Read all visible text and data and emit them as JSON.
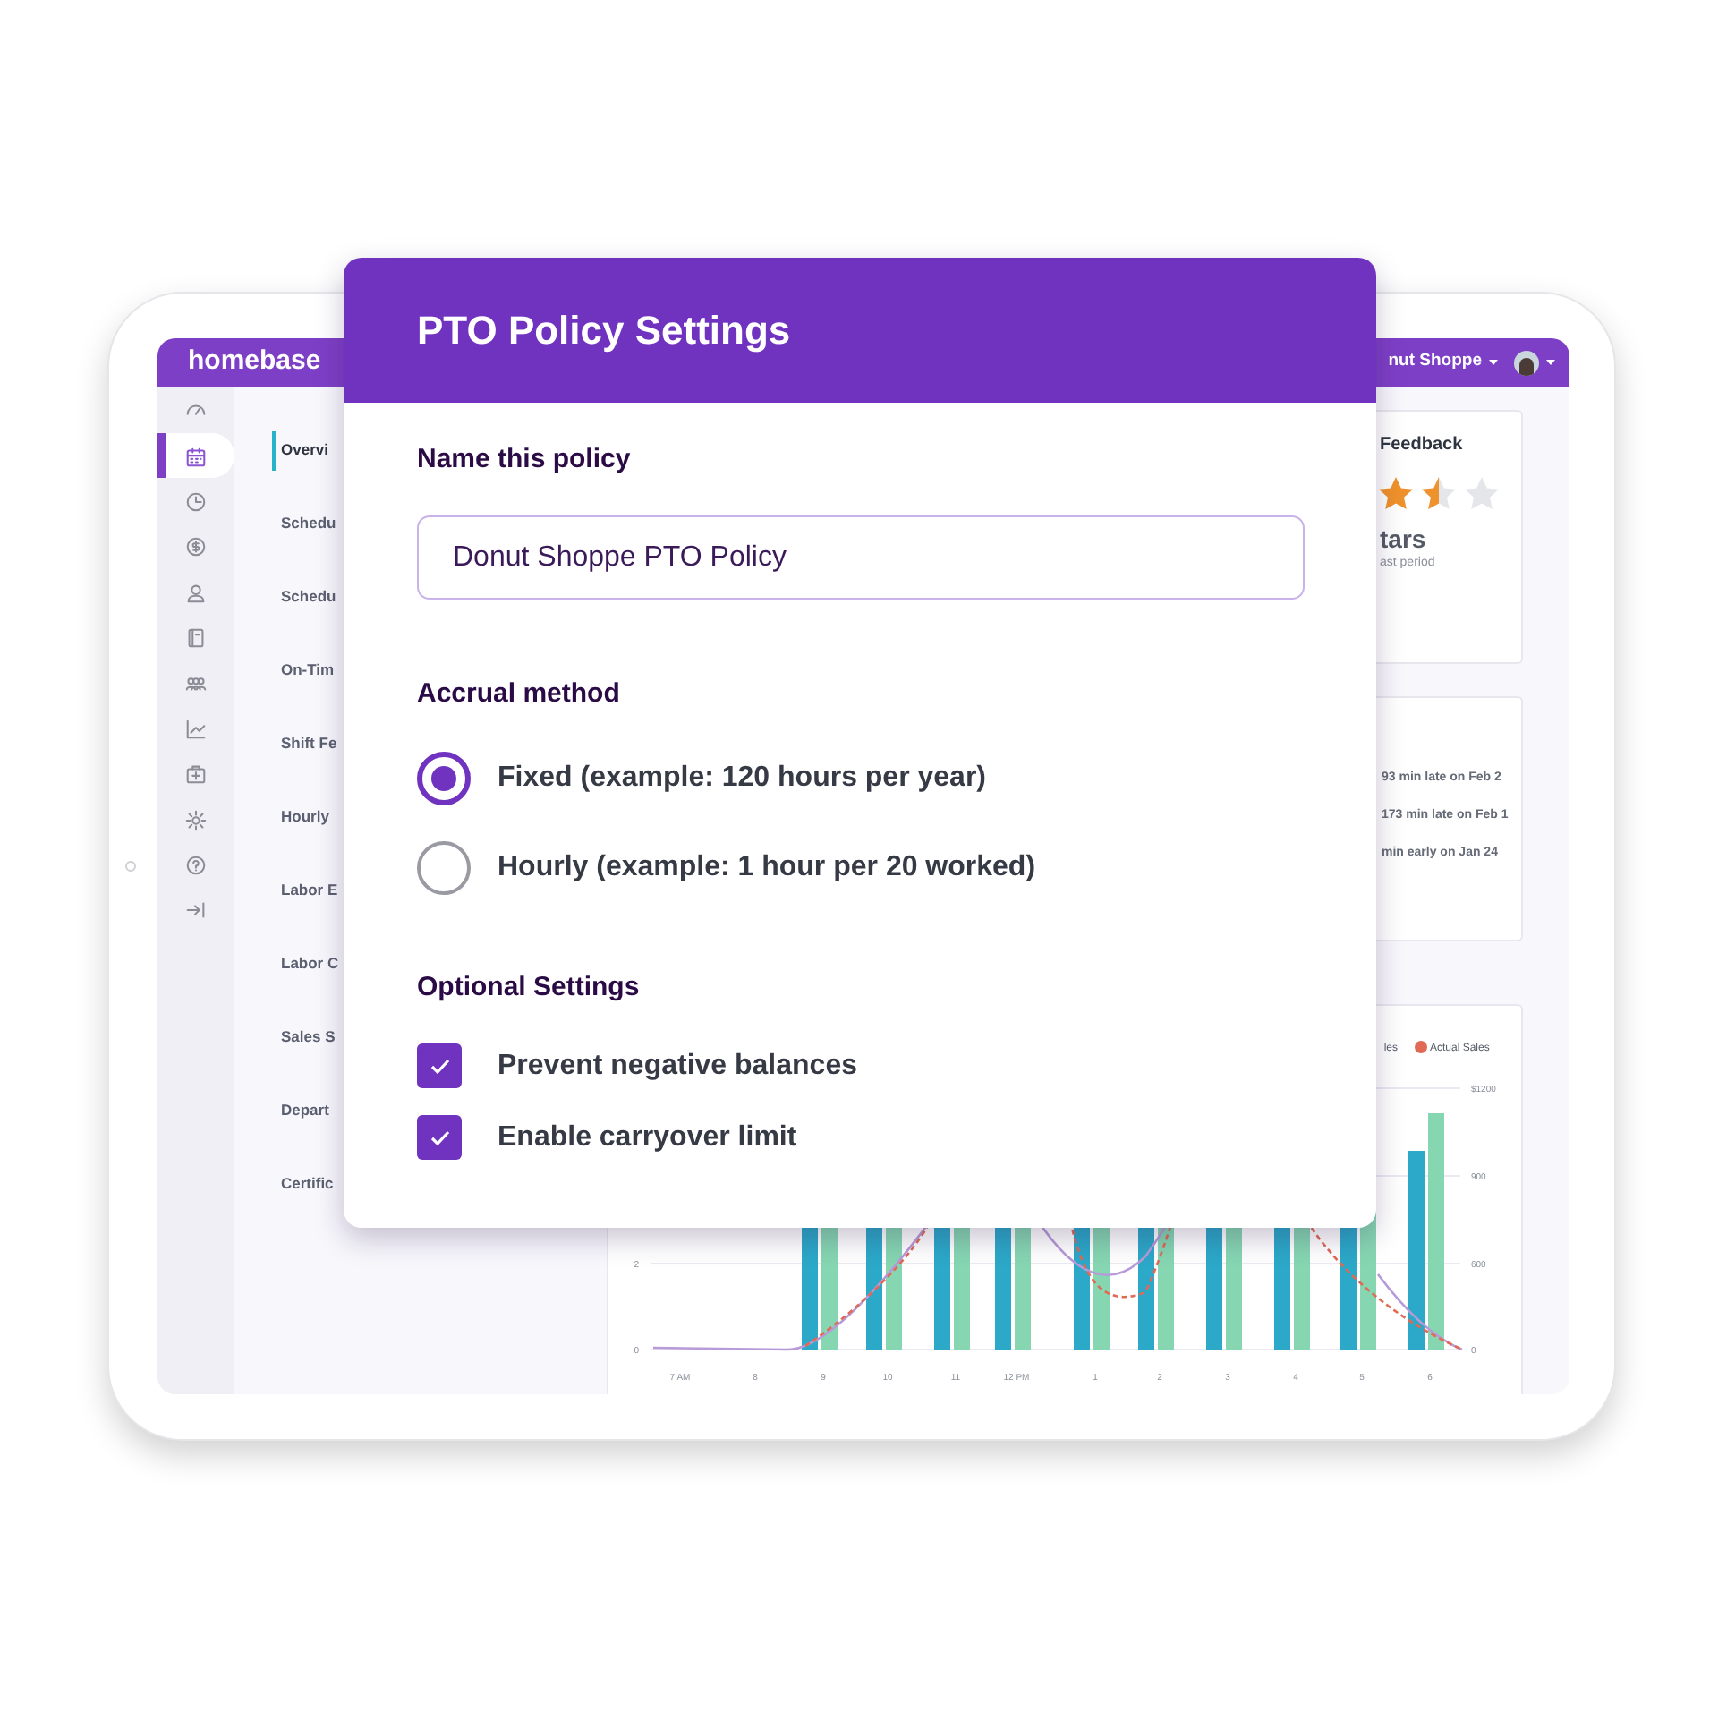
{
  "app": {
    "logo": "homebase",
    "location": "nut Shoppe"
  },
  "sidebar": {
    "icons": [
      {
        "selected": false
      },
      {
        "selected": true
      },
      {
        "selected": false
      },
      {
        "selected": false
      },
      {
        "selected": false
      },
      {
        "selected": false
      },
      {
        "selected": false
      },
      {
        "selected": false
      },
      {
        "selected": false
      },
      {
        "selected": false
      },
      {
        "selected": false
      },
      {
        "selected": false
      }
    ]
  },
  "nav": [
    {
      "label": "Overvi",
      "selected": true
    },
    {
      "label": "Schedu",
      "selected": false
    },
    {
      "label": "Schedu",
      "selected": false
    },
    {
      "label": "On-Tim",
      "selected": false
    },
    {
      "label": "Shift Fe",
      "selected": false
    },
    {
      "label": "Hourly",
      "selected": false
    },
    {
      "label": "Labor E",
      "selected": false
    },
    {
      "label": "Labor C",
      "selected": false
    },
    {
      "label": "Sales S",
      "selected": false
    },
    {
      "label": "Depart",
      "selected": false
    },
    {
      "label": "Certific",
      "selected": false
    }
  ],
  "feedback_card": {
    "title": "Feedback",
    "stars": 1.5,
    "rating": "tars",
    "caption": "ast period"
  },
  "punctuality_card": {
    "lines": [
      "93 min late on Feb 2",
      "173 min late on Feb 1",
      "min early on Jan 24"
    ]
  },
  "sales_chart": {
    "legend": [
      {
        "label": "les"
      },
      {
        "label": "Actual Sales",
        "color": "#e06a55"
      }
    ],
    "left_ticks": [
      "2",
      "0"
    ],
    "right_ticks": [
      "$1200",
      "900",
      "600",
      "0"
    ],
    "x_labels": [
      "7 AM",
      "8",
      "9",
      "10",
      "11",
      "12 PM",
      "1",
      "2",
      "3",
      "4",
      "5",
      "6"
    ]
  },
  "modal": {
    "title": "PTO Policy Settings",
    "name_label": "Name this policy",
    "name_field": {
      "value": "Donut Shoppe PTO Policy"
    },
    "accrual_label": "Accrual method",
    "accrual_options": [
      {
        "label": "Fixed (example: 120 hours per year)",
        "selected": true
      },
      {
        "label": "Hourly (example: 1 hour per 20 worked)",
        "selected": false
      }
    ],
    "optional_label": "Optional Settings",
    "optional_settings": [
      {
        "label": "Prevent negative balances",
        "checked": true
      },
      {
        "label": "Enable carryover limit",
        "checked": true
      }
    ]
  }
}
